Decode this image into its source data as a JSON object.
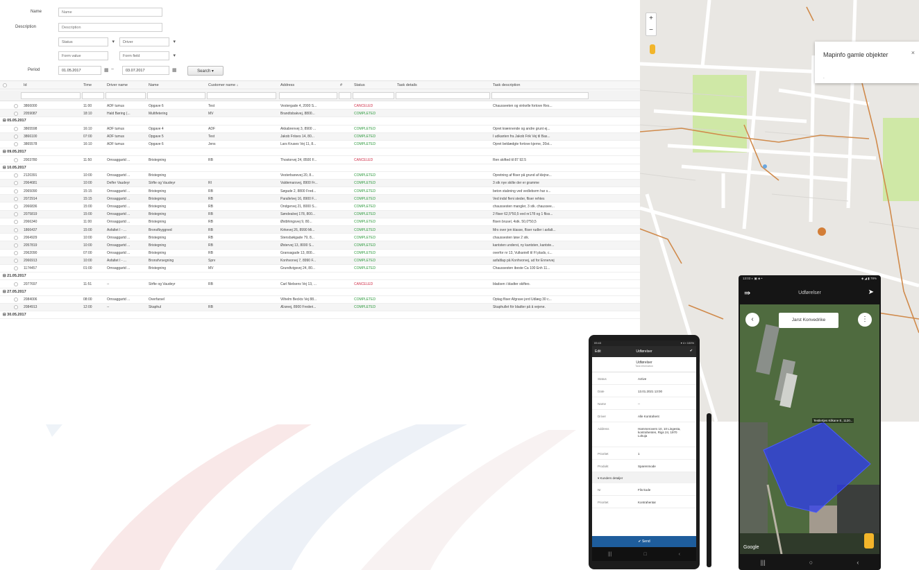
{
  "filters": {
    "name_label": "Name",
    "name_placeholder": "Name",
    "description_label": "Description",
    "description_placeholder": "Description",
    "status_value": "Status",
    "driver_value": "Driver",
    "form_value": "Form value",
    "form_field": "Form field",
    "period_label": "Period",
    "date_from": "01.05.2017",
    "date_to": "03.07.2017",
    "range_sep": "~",
    "search_label": "Search ▾"
  },
  "table": {
    "headers": [
      "Id",
      "Time",
      "Driver name",
      "Name",
      "Customer name ↓",
      "Address",
      "#",
      "Status",
      "Task details",
      "Task description"
    ],
    "rows": [
      {
        "type": "item",
        "id": "3866000",
        "time": "11:00",
        "driver": "ADF tumus",
        "name": "Opgave 6",
        "customer": "Test",
        "address": "Vestergade 4, 2000 S...",
        "status": "CANCELED",
        "details": "",
        "desc": "Chausseeten og vinkelle fortove Res..."
      },
      {
        "type": "item",
        "id": "2059087",
        "time": "18:10",
        "driver": "Hald Børing (...",
        "name": "Multifetering",
        "customer": "MV",
        "address": "Brandtsbakvej, 8800...",
        "status": "COMPLETED",
        "details": "",
        "desc": ""
      },
      {
        "type": "group",
        "label": "05.05.2017"
      },
      {
        "type": "item",
        "id": "3865598",
        "time": "16:10",
        "driver": "ADF tumus",
        "name": "Opgave 4",
        "customer": "ADF",
        "address": "Akkabrenvej 3, 8900 ...",
        "status": "COMPLETED",
        "details": "",
        "desc": "Opret krænnende og andre grunt ej..."
      },
      {
        "type": "item",
        "id": "3866100",
        "time": "07:00",
        "driver": "ADF tumus",
        "name": "Opgave 5",
        "customer": "Test",
        "address": "Jakob Friises 14, 80...",
        "status": "COMPLETED",
        "details": "",
        "desc": "I udkanten fra Jakob Frik Vej til Bas..."
      },
      {
        "type": "item",
        "id": "3865578",
        "time": "16:10",
        "driver": "ADF tumus",
        "name": "Opgave 6",
        "customer": "Jens",
        "address": "Lars Kruses Vej 11, 8...",
        "status": "COMPLETED",
        "details": "",
        "desc": "Opret beklædgte fortove kjerne, 20st..."
      },
      {
        "type": "group",
        "label": "09.05.2017"
      },
      {
        "type": "item",
        "id": "2003780",
        "time": "11:50",
        "driver": "Ornsaggartd ...",
        "name": "Bristegning",
        "customer": "RB",
        "address": "Thostorvej 24, 8500 F...",
        "status": "CANCELED",
        "details": "",
        "desc": "Ren skifted til 87 92.5"
      },
      {
        "type": "group",
        "label": "10.05.2017"
      },
      {
        "type": "item",
        "id": "2120391",
        "time": "10:00",
        "driver": "Ornsaggartd ...",
        "name": "Bristegning",
        "customer": "",
        "address": "Vesterbanevej 20, 8...",
        "status": "COMPLETED",
        "details": "",
        "desc": "Opretning af fliser på grund af klejne..."
      },
      {
        "type": "item",
        "id": "2064681",
        "time": "10:00",
        "driver": "Delfer Vaudeyr",
        "name": "Strfte og Vaudeyr",
        "customer": "RI",
        "address": "Valdemarsvej, 8900 Fr...",
        "status": "COMPLETED",
        "details": "",
        "desc": "3 stk nye skilte der er gramme"
      },
      {
        "type": "item",
        "id": "2065090",
        "time": "15:15",
        "driver": "Ornsaggartd ...",
        "name": "Bristegning",
        "customer": "RB",
        "address": "Søgade 2, 8800 Fred...",
        "status": "COMPLETED",
        "details": "",
        "desc": "beton stabning ved vedlebsrm har s..."
      },
      {
        "type": "item",
        "id": "2072914",
        "time": "15:15",
        "driver": "Ornsaggartd ...",
        "name": "Bristegning",
        "customer": "RB",
        "address": "Parallelvej 16, 8900 F...",
        "status": "COMPLETED",
        "details": "",
        "desc": "Ved indsl fleni steder, fliser rehtes"
      },
      {
        "type": "item",
        "id": "2066836",
        "time": "15:00",
        "driver": "Ornsaggartd ...",
        "name": "Bristegning",
        "customer": "RB",
        "address": "Ondgervej 21, 8000 S...",
        "status": "COMPLETED",
        "details": "",
        "desc": "chaussesten mangler, 3 stk. chaussee..."
      },
      {
        "type": "item",
        "id": "2075819",
        "time": "15:00",
        "driver": "Ornsaggartd ...",
        "name": "Bristegning",
        "customer": "RB",
        "address": "Søndealvej 178, 800...",
        "status": "COMPLETED",
        "details": "",
        "desc": "2 fliser 62,5*50,5 ved nr178 og 1 fliss..."
      },
      {
        "type": "item",
        "id": "2066340",
        "time": "11:00",
        "driver": "Ornsaggartd ...",
        "name": "Bristegning",
        "customer": "RB",
        "address": "Østbhingsvej 9, 80...",
        "status": "COMPLETED",
        "details": "",
        "desc": "flisen brusel, 4stk. 50,0*50,5"
      },
      {
        "type": "item",
        "id": "1866437",
        "time": "15:00",
        "driver": "Asfaltet I - ...",
        "name": "Bronsfbyggned",
        "customer": "RB",
        "address": "Kirkevej 26, 8990 Mi...",
        "status": "COMPLETED",
        "details": "",
        "desc": "Mrs over jen klasse, fliser rudler i asfalt..."
      },
      {
        "type": "item",
        "id": "2064929",
        "time": "10:00",
        "driver": "Ornsaggartd ...",
        "name": "Bristegning",
        "customer": "RB",
        "address": "Stensbøkgade 79, 8...",
        "status": "COMPLETED",
        "details": "",
        "desc": "chaussesten løse 2 stk."
      },
      {
        "type": "item",
        "id": "2057819",
        "time": "10:00",
        "driver": "Ornsaggartd ...",
        "name": "Bristegning",
        "customer": "RB",
        "address": "Østervej 13, 8000 S...",
        "status": "COMPLETED",
        "details": "",
        "desc": "kantsten underst, ny kantsten, kantste..."
      },
      {
        "type": "item",
        "id": "2062090",
        "time": "07:00",
        "driver": "Ornsaggartd ...",
        "name": "Bristegning",
        "customer": "RB",
        "address": "Gransagade 13, 800...",
        "status": "COMPLETED",
        "details": "",
        "desc": "overfor nr 13, Vulkaniell til Fl plads, c..."
      },
      {
        "type": "item",
        "id": "2066913",
        "time": "10:00",
        "driver": "Asfaltet I - ...",
        "name": "Bronsfvrsegning",
        "customer": "Sprv",
        "address": "Konhvorvej 7, 8990 F...",
        "status": "COMPLETED",
        "details": "",
        "desc": "asfaltlap på Konhvorvej, ud for Ennervej"
      },
      {
        "type": "item",
        "id": "1174457",
        "time": "01:00",
        "driver": "Ornsaggartd ...",
        "name": "Bristegning",
        "customer": "MV",
        "address": "Grundtvigsvej 24, 80...",
        "status": "COMPLETED",
        "details": "",
        "desc": "Chaussesten ibeste Ca 100 Enh 11..."
      },
      {
        "type": "group",
        "label": "21.05.2017"
      },
      {
        "type": "item",
        "id": "2077697",
        "time": "11:51",
        "driver": "--",
        "name": "Strfte og Vaudeyr",
        "customer": "RB",
        "address": "Carl Nielsens Vej 13, ...",
        "status": "CANCELED",
        "details": "",
        "desc": "bladsen i bladter skifteo."
      },
      {
        "type": "group",
        "label": "27.05.2017"
      },
      {
        "type": "item",
        "id": "2084006",
        "time": "08:00",
        "driver": "Ornsaggartd ...",
        "name": "Overfarsel",
        "customer": "",
        "address": "Vilhelm Beckts Vej 88...",
        "status": "COMPLETED",
        "details": "",
        "desc": "Optag fliser Afgrave jord Udlæg 30 c..."
      },
      {
        "type": "item",
        "id": "2084913",
        "time": "12:00",
        "driver": "--",
        "name": "Skaphul",
        "customer": "RB",
        "address": "Ærøvej, 8900 Frederi...",
        "status": "COMPLETED",
        "details": "",
        "desc": "Skaphullet fór bladter på å vejene."
      },
      {
        "type": "group",
        "label": "30.05.2017"
      }
    ]
  },
  "map": {
    "zoom_in": "+",
    "zoom_out": "−",
    "popup_title": "Mapinfo gamle objekter",
    "popup_close": "×",
    "popup_body": "-"
  },
  "phone1": {
    "status_time": "09:43",
    "status_right": "▾ 4 ▪ 100%",
    "bar_left": "Edit",
    "bar_title": "Udførelser",
    "bar_right": "✔",
    "head_title": "Udførelser",
    "head_sub": "Task information",
    "fields": [
      {
        "k": "Status",
        "v": "Active"
      },
      {
        "k": "Date",
        "v": "13.01.2021 13:00"
      },
      {
        "k": "Name",
        "v": "--"
      },
      {
        "k": "Driver",
        "v": "Alle Kontrahent"
      },
      {
        "k": "Address",
        "v": "Hammerovers 10, 10 Lingesta, kontrahenten, Rigs 24, 1970 Lokuja"
      },
      {
        "k": "Prioritet",
        "v": "1"
      },
      {
        "k": "Produkt",
        "v": "Sparenmode"
      }
    ],
    "section": "Kunders detaljer",
    "section_fields": [
      {
        "k": "Nr",
        "v": "Flis-kode"
      },
      {
        "k": "Prioritet",
        "v": "Kontrahentar"
      }
    ],
    "save": "Send",
    "nav": [
      "|||",
      "□",
      "‹"
    ]
  },
  "phone2": {
    "status_left": "13:03 ◐ ▣ ◈ •",
    "status_right": "◈ ◢ ▮ 78%",
    "bar_title": "Udførelser",
    "chip": "Jarst Konvedrike",
    "label": "Testlertjes Kilkane E, 1120...",
    "google": "Google",
    "nav": [
      "|||",
      "○",
      "‹"
    ]
  },
  "colors": {
    "completed": "#2e9a3e",
    "canceled": "#d0304a",
    "polygon": "#2d3cf0",
    "save_bar": "#1e5d9c"
  }
}
